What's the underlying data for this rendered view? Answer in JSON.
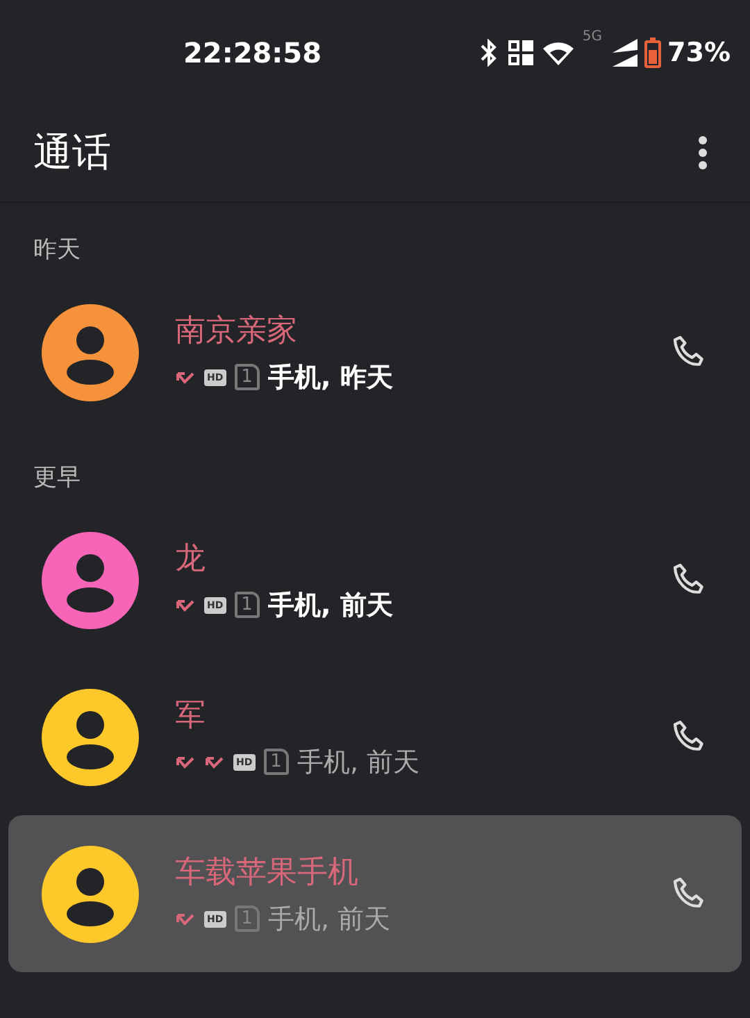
{
  "status_bar": {
    "time": "22:28:58",
    "network": "5G",
    "battery": "73%"
  },
  "header": {
    "title": "通话"
  },
  "sections": [
    {
      "title": "昨天",
      "calls": [
        {
          "name": "南京亲家",
          "call_types": [
            {
              "kind": "missed"
            }
          ],
          "hd": "HD",
          "sim": "1",
          "detail": "手机, 昨天",
          "unread": true,
          "selected": false,
          "color": "#f6923c"
        }
      ]
    },
    {
      "title": "更早",
      "calls": [
        {
          "name": "龙",
          "call_types": [
            {
              "kind": "missed"
            }
          ],
          "hd": "HD",
          "sim": "1",
          "detail": "手机, 前天",
          "unread": true,
          "selected": false,
          "color": "#f765b9"
        },
        {
          "name": "军",
          "call_types": [
            {
              "kind": "missed"
            },
            {
              "kind": "missed"
            }
          ],
          "hd": "HD",
          "sim": "1",
          "detail": "手机, 前天",
          "unread": false,
          "selected": false,
          "color": "#fdc829"
        },
        {
          "name": "车载苹果手机",
          "call_types": [
            {
              "kind": "missed"
            }
          ],
          "hd": "HD",
          "sim": "1",
          "detail": "手机, 前天",
          "unread": false,
          "selected": true,
          "color": "#fdc829"
        }
      ]
    }
  ]
}
